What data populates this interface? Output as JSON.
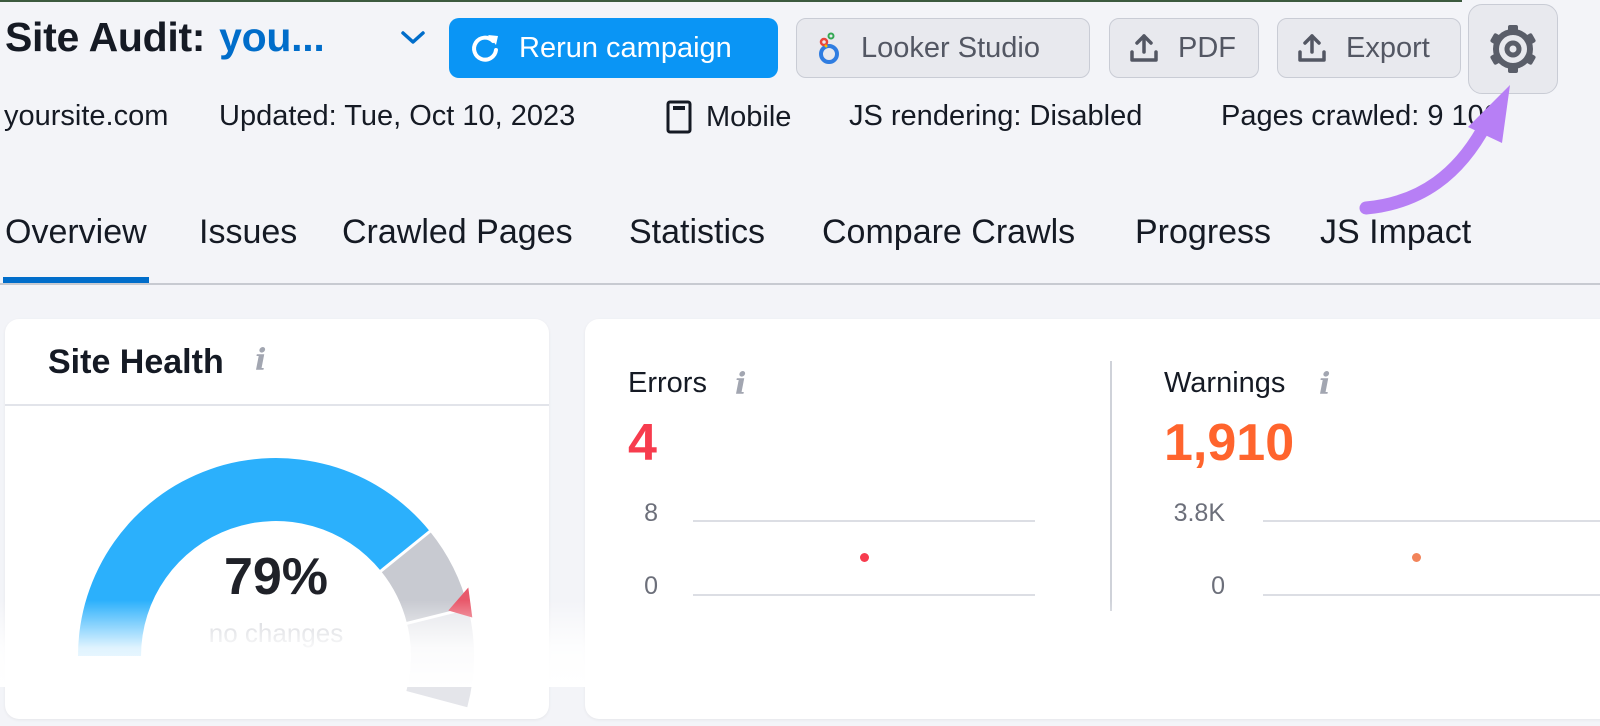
{
  "header": {
    "title": "Site Audit:",
    "project": "you...",
    "buttons": {
      "rerun": "Rerun campaign",
      "looker": "Looker Studio",
      "pdf": "PDF",
      "export": "Export"
    },
    "icons": {
      "project_dropdown": "chevron-down-icon",
      "rerun": "refresh-icon",
      "looker": "looker-studio-logo-icon",
      "pdf": "upload-icon",
      "export": "upload-icon",
      "settings": "gear-icon"
    }
  },
  "meta": {
    "domain": "yoursite.com",
    "updated": "Updated: Tue, Oct 10, 2023",
    "device": "Mobile",
    "js_rendering": "JS rendering: Disabled",
    "pages_crawled": "Pages crawled: 9  100"
  },
  "tabs": [
    {
      "label": "Overview",
      "active": true
    },
    {
      "label": "Issues",
      "active": false
    },
    {
      "label": "Crawled Pages",
      "active": false
    },
    {
      "label": "Statistics",
      "active": false
    },
    {
      "label": "Compare Crawls",
      "active": false
    },
    {
      "label": "Progress",
      "active": false
    },
    {
      "label": "JS Impact",
      "active": false
    }
  ],
  "site_health": {
    "title": "Site Health",
    "info_icon": "i",
    "value_percent": 79,
    "value_label": "79%",
    "change_label": "no changes",
    "colors": {
      "score": "#2bb0fc",
      "remainder": "#c8cad1",
      "marker": "#e8586a"
    }
  },
  "errors": {
    "label": "Errors",
    "info_icon": "i",
    "value": "4",
    "color": "#f73c4e",
    "axis": {
      "max_label": "8",
      "min_label": "0"
    },
    "point": {
      "value": 4
    }
  },
  "warnings": {
    "label": "Warnings",
    "info_icon": "i",
    "value": "1,910",
    "color": "#ff642d",
    "axis": {
      "max_label": "3.8K",
      "min_label": "0"
    },
    "point": {
      "value": 1910
    }
  },
  "annotation": {
    "color": "#b77ff5"
  }
}
